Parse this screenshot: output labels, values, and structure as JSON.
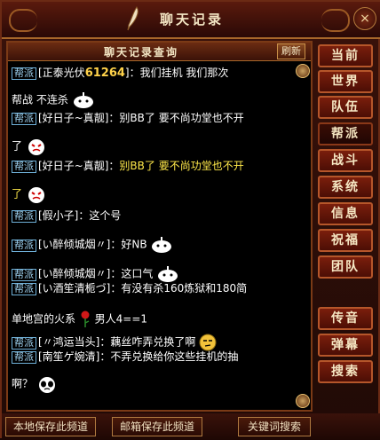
{
  "window": {
    "title": "聊天记录",
    "close_label": "×"
  },
  "chat": {
    "header_title": "聊天记录查询",
    "refresh_label": "刷新",
    "messages": [
      {
        "tag": "帮派",
        "name": "[正泰光伏",
        "num": "61264",
        "after": "]：我们挂机 我们那次",
        "cont": "帮战 不连杀",
        "emote": "ghost"
      },
      {
        "tag": "帮派",
        "name": "[好日子~真靓]：",
        "text": "别BB了 要不尚功堂也不开",
        "cont": "了",
        "emote": "angry"
      },
      {
        "tag": "帮派",
        "name": "[好日子~真靓]：",
        "text": "别BB了 要不尚功堂也不开",
        "cont": "了",
        "emote": "angry",
        "yellow": true
      },
      {
        "tag": "帮派",
        "name": "[假小子]：",
        "text": "这个号"
      },
      {
        "tag": "帮派",
        "name": "[い醉倾城烟〃]：",
        "text": "好NB",
        "emote": "ghost"
      },
      {
        "tag": "帮派",
        "name": "[い醉倾城烟〃]：",
        "text": "这口气",
        "emote": "ghost"
      },
      {
        "tag": "帮派",
        "name": "[い酒笙清栀づ]：",
        "text": "有没有杀160炼狱和180简",
        "cont": "单地宫的火系",
        "cont2": "男人4==1",
        "emote": "rose"
      },
      {
        "tag": "帮派",
        "name": "[〃鸿运当头]：",
        "text": "藕丝咋弄兑换了啊",
        "emote": "smirk"
      },
      {
        "tag": "帮派",
        "name": "[南笙ゲ婉清]：",
        "text": "不弄兑换给你这些挂机的抽",
        "cont": "啊？",
        "emote": "panda"
      }
    ]
  },
  "sidebar": {
    "buttons": [
      "当前",
      "世界",
      "队伍",
      "帮派",
      "战斗",
      "系统",
      "信息",
      "祝福",
      "团队",
      "传音",
      "弹幕",
      "搜索"
    ]
  },
  "bottom": {
    "save_local": "本地保存此频道",
    "save_mail": "邮箱保存此频道",
    "keyword_search": "关键词搜索"
  },
  "colors": {
    "tag_border": "#6fb0d8",
    "yellow_text": "#ffe94a",
    "accent": "#b5562a"
  }
}
